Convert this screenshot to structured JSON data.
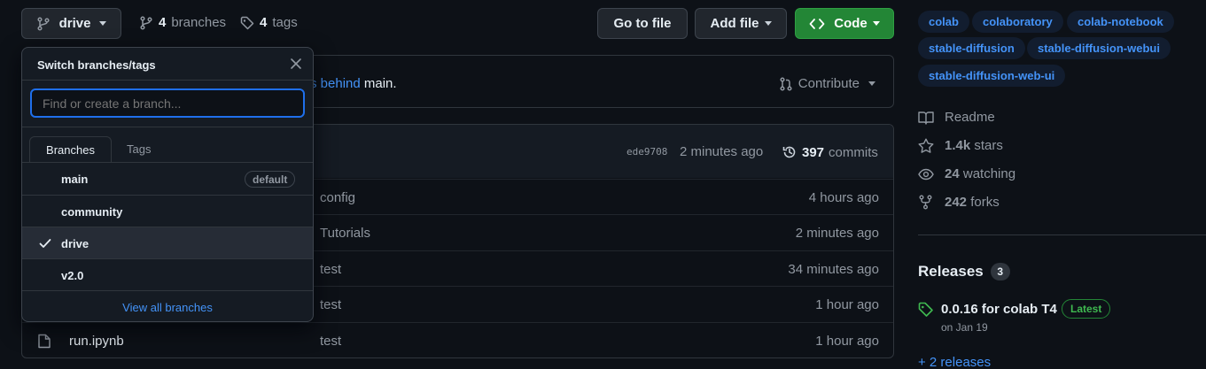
{
  "toolbar": {
    "branch_label": "drive",
    "branches_count": "4",
    "branches_label": "branches",
    "tags_count": "4",
    "tags_label": "tags",
    "go_to_file": "Go to file",
    "add_file": "Add file",
    "code": "Code"
  },
  "banner": {
    "link_text": "s behind",
    "text": "main.",
    "contribute": "Contribute"
  },
  "commit_bar": {
    "sha": "ede9708",
    "time": "2 minutes ago",
    "commits_count": "397",
    "commits_label": "commits"
  },
  "files": [
    {
      "name": "",
      "message": "config",
      "age": "4 hours ago"
    },
    {
      "name": "",
      "message": "Tutorials",
      "age": "2 minutes ago"
    },
    {
      "name": "",
      "message": "test",
      "age": "34 minutes ago"
    },
    {
      "name": "",
      "message": "test",
      "age": "1 hour ago"
    },
    {
      "name": "run.ipynb",
      "message": "test",
      "age": "1 hour ago"
    }
  ],
  "dropdown": {
    "title": "Switch branches/tags",
    "placeholder": "Find or create a branch...",
    "tabs": [
      "Branches",
      "Tags"
    ],
    "branches": [
      {
        "name": "main",
        "badge": "default"
      },
      {
        "name": "community"
      },
      {
        "name": "drive",
        "selected": true
      },
      {
        "name": "v2.0"
      }
    ],
    "view_all": "View all branches"
  },
  "sidebar": {
    "topics": [
      "colab",
      "colaboratory",
      "colab-notebook",
      "stable-diffusion",
      "stable-diffusion-webui",
      "stable-diffusion-web-ui"
    ],
    "readme": "Readme",
    "stars_count": "1.4k",
    "stars_label": "stars",
    "watching_count": "24",
    "watching_label": "watching",
    "forks_count": "242",
    "forks_label": "forks",
    "releases_title": "Releases",
    "releases_count": "3",
    "release_name": "0.0.16 for colab T4",
    "release_badge": "Latest",
    "release_date": "on Jan 19",
    "more_releases": "+ 2 releases"
  },
  "colors": {
    "background": "#0d1117",
    "accent": "#4493f8",
    "code_button": "#238636",
    "latest_badge": "#3fb950"
  }
}
